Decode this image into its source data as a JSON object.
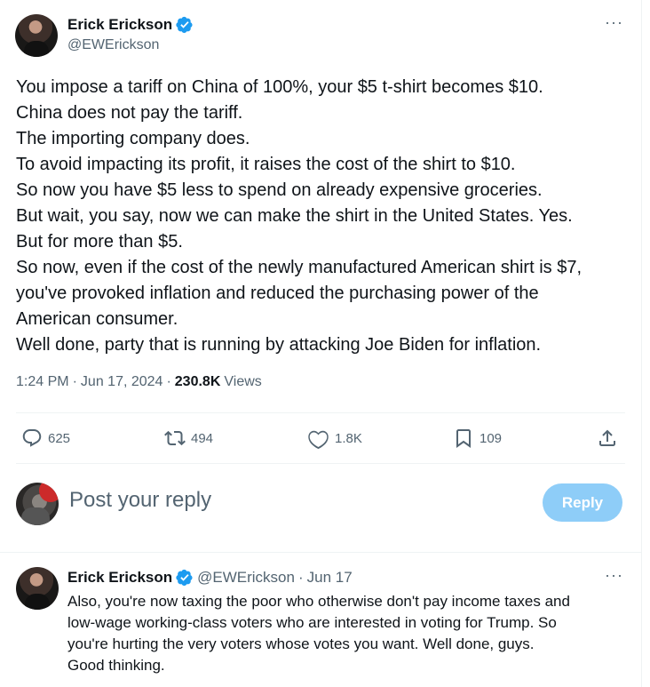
{
  "main_tweet": {
    "author_name": "Erick Erickson",
    "author_handle": "@EWErickson",
    "more_label": "···",
    "lines": [
      "You impose a tariff on China of 100%, your $5 t-shirt becomes $10.",
      "China does not pay the tariff.",
      "The importing company does.",
      "To avoid impacting its profit, it raises the cost of the shirt to $10.",
      "So now you have $5 less to spend on already expensive groceries.",
      "But wait, you say, now we can make the shirt in the United States.  Yes.",
      "But for more than $5.",
      "So now, even if the cost of the newly manufactured American shirt is $7,",
      "you've provoked inflation and reduced the purchasing power of the",
      "American consumer.",
      "Well done, party that is running by attacking Joe Biden for inflation."
    ],
    "time": "1:24 PM",
    "date": "Jun 17, 2024",
    "sep": "·",
    "views_count": "230.8K",
    "views_label": "Views",
    "stats": {
      "replies": "625",
      "retweets": "494",
      "likes": "1.8K",
      "bookmarks": "109"
    }
  },
  "composer": {
    "placeholder": "Post your reply",
    "button_label": "Reply"
  },
  "reply_tweet": {
    "author_name": "Erick Erickson",
    "author_handle": "@EWErickson",
    "sep": "·",
    "date": "Jun 17",
    "more_label": "···",
    "lines": [
      "Also, you're now taxing the poor who otherwise don't pay income taxes and",
      "low-wage working-class voters who are interested in voting for Trump.  So",
      "you're hurting the very voters whose votes you want.  Well done, guys.",
      "Good thinking."
    ]
  },
  "colors": {
    "text": "#0f1419",
    "secondary": "#536471",
    "verified": "#1d9bf0",
    "reply_button": "#8ecdf8",
    "divider": "#eff3f4"
  },
  "icons": {
    "verified": "verified-badge-icon",
    "reply": "reply-icon",
    "retweet": "retweet-icon",
    "like": "heart-icon",
    "bookmark": "bookmark-icon",
    "share": "share-icon",
    "more": "more-icon"
  }
}
